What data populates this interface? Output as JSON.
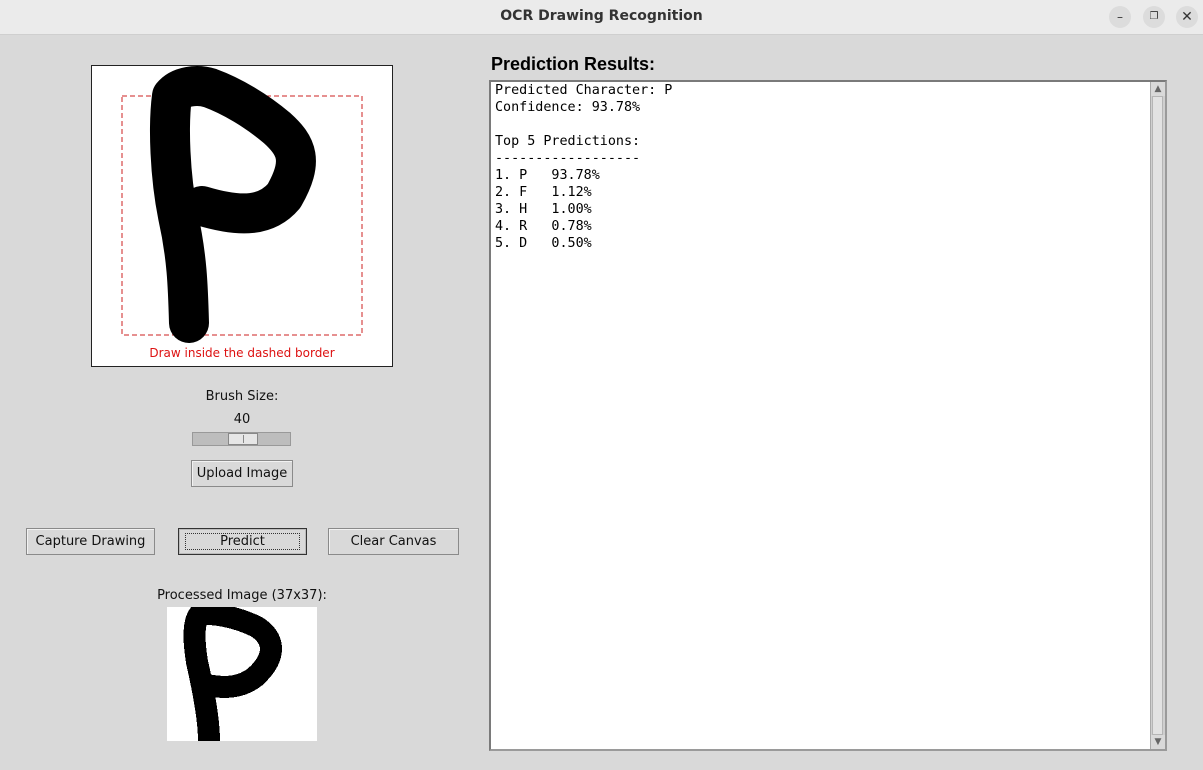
{
  "window": {
    "title": "OCR Drawing Recognition",
    "minimize_glyph": "–",
    "maximize_glyph": "❐",
    "close_glyph": "✕"
  },
  "canvas": {
    "hint": "Draw inside the dashed border",
    "border_color": "#cc2222"
  },
  "brush": {
    "label": "Brush Size:",
    "value": "40",
    "level_fraction": 0.4
  },
  "buttons": {
    "upload": "Upload Image",
    "capture": "Capture Drawing",
    "predict": "Predict",
    "clear": "Clear Canvas"
  },
  "processed": {
    "label": "Processed Image (37x37):"
  },
  "results": {
    "title": "Prediction Results:",
    "predicted_line": "Predicted Character: P",
    "confidence_line": "Confidence: 93.78%",
    "top_header": "Top 5 Predictions:",
    "divider": "------------------",
    "predictions": [
      "1. P   93.78%",
      "2. F   1.12%",
      "3. H   1.00%",
      "4. R   0.78%",
      "5. D   0.50%"
    ]
  }
}
